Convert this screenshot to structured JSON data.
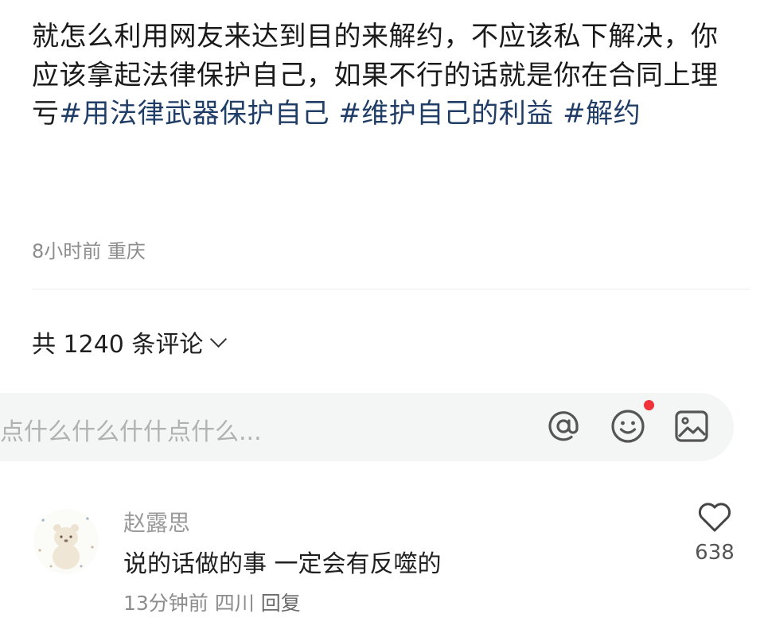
{
  "post": {
    "body_text": "就怎么利用网友来达到目的来解约，不应该私下解决，你应该拿起法律保护自己，如果不行的话就是你在合同上理亏",
    "hashtags": [
      "#用法律武器保护自己",
      "#维护自己的利益",
      "#解约"
    ],
    "time": "8小时前",
    "location": "重庆"
  },
  "comments_header": {
    "label": "共 1240 条评论"
  },
  "input_bar": {
    "placeholder": "点什么什么什什点什么...",
    "icons": [
      "at-icon",
      "emoji-icon",
      "image-icon"
    ],
    "notification_color": "#f0323a"
  },
  "comment": {
    "author": "赵露思",
    "text": "说的话做的事 一定会有反噬的",
    "time": "13分钟前",
    "location": "四川",
    "reply_label": "回复",
    "likes": "638"
  },
  "colors": {
    "hashtag": "#1f3d66",
    "meta": "#8c8c8c",
    "input_bg": "#f4f5f5"
  }
}
